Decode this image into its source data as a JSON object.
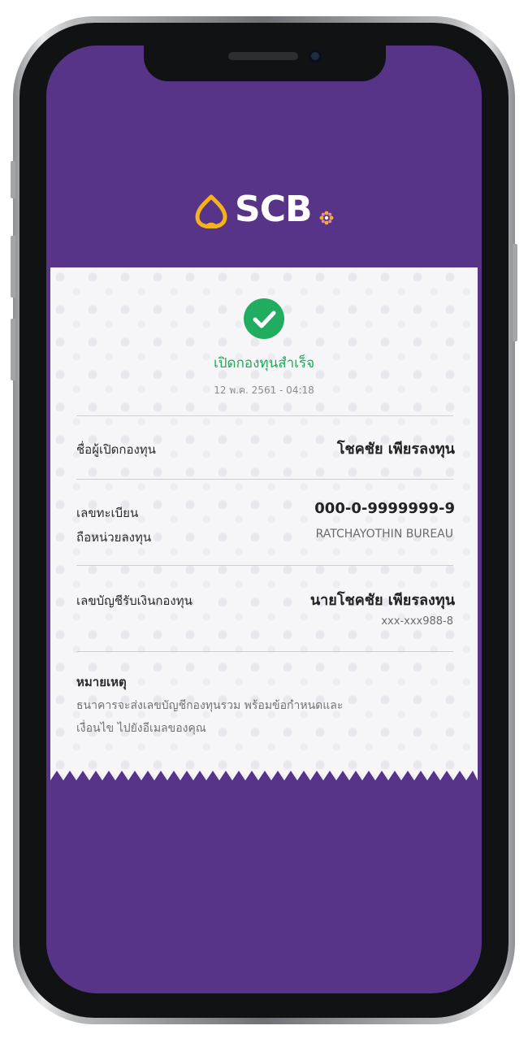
{
  "brand": {
    "name": "SCB",
    "color": "#573488",
    "accent": "#f5b21c"
  },
  "receipt": {
    "status_text": "เปิดกองทุนสำเร็จ",
    "datetime": "12 พ.ค. 2561 - 04:18",
    "rows": [
      {
        "label": "ชื่อผู้เปิดกองทุน",
        "value": "โชคชัย เพียรลงทุน"
      },
      {
        "label": "เลขทะเบียน",
        "value": "000-0-9999999-9"
      },
      {
        "label": "ถือหน่วยลงทุน",
        "value": "RATCHAYOTHIN BUREAU"
      },
      {
        "label": "เลขบัญชีรับเงินกองทุน",
        "value": "นายโชคชัย เพียรลงทุน",
        "sub": "xxx-xxx988-8"
      }
    ],
    "note": {
      "title": "หมายเหตุ",
      "lines": [
        "ธนาคารจะส่งเลขบัญชีกองทุนรวม พร้อมข้อกำหนดและ",
        "เงื่อนไข ไปยังอีเมลของคุณ"
      ]
    }
  },
  "icons": {
    "success": "check-circle-icon",
    "logo": "scb-lotus-icon"
  }
}
